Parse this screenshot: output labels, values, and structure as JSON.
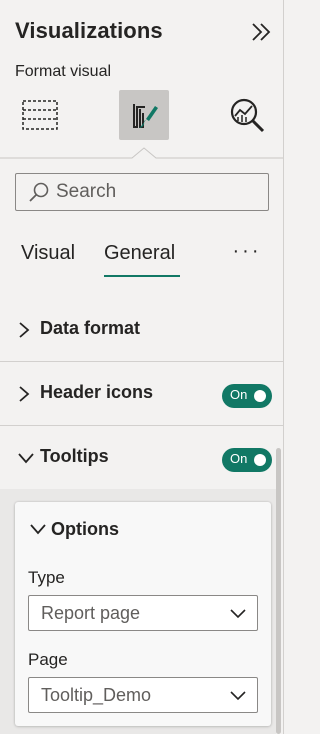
{
  "panel": {
    "title": "Visualizations",
    "subtitle": "Format visual",
    "collapse_icon": "double-chevron-right-icon"
  },
  "viz_tabs": [
    {
      "name": "build-visual",
      "icon": "dashed-grid-icon",
      "active": false
    },
    {
      "name": "format-visual",
      "icon": "paintbrush-icon",
      "active": true
    },
    {
      "name": "analytics",
      "icon": "magnifier-chart-icon",
      "active": false
    }
  ],
  "search": {
    "placeholder": "Search",
    "icon": "search-icon"
  },
  "format_tabs": {
    "visual": "Visual",
    "general": "General",
    "active": "General",
    "more": "···"
  },
  "sections": {
    "data_format": {
      "label": "Data format",
      "expanded": false
    },
    "header_icons": {
      "label": "Header icons",
      "toggle": "On",
      "expanded": false
    },
    "tooltips": {
      "label": "Tooltips",
      "toggle": "On",
      "expanded": true
    }
  },
  "options": {
    "label": "Options",
    "type_label": "Type",
    "type_value": "Report page",
    "page_label": "Page",
    "page_value": "Tooltip_Demo"
  },
  "colors": {
    "accent": "#117865",
    "background": "#f3f2f1"
  }
}
